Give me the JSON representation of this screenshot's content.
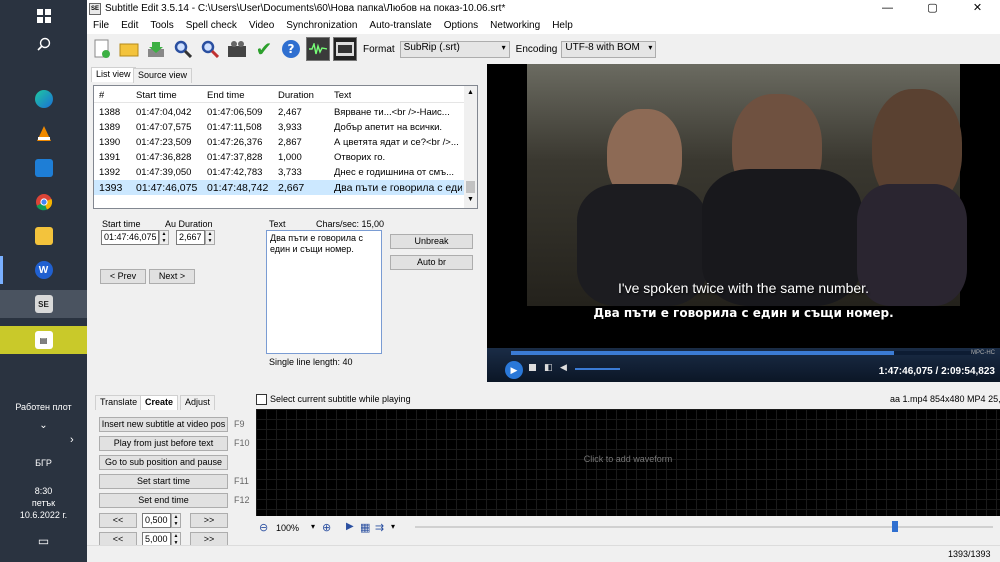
{
  "taskbar": {
    "desktop_label": "Работен плот",
    "chevron_down": "»",
    "language": "БГР",
    "time": "8:30",
    "weekday": "петък",
    "date": "10.6.2022 г."
  },
  "window": {
    "title": "Subtitle Edit 3.5.14 - C:\\Users\\User\\Documents\\60\\Нова папка\\Любов на показ-10.06.srt*"
  },
  "menu": [
    "File",
    "Edit",
    "Tools",
    "Spell check",
    "Video",
    "Synchronization",
    "Auto-translate",
    "Options",
    "Networking",
    "Help"
  ],
  "toolbar": {
    "format_label": "Format",
    "format_value": "SubRip (.srt)",
    "encoding_label": "Encoding",
    "encoding_value": "UTF-8 with BOM"
  },
  "tabs": {
    "list_view": "List view",
    "source_view": "Source view"
  },
  "list": {
    "columns": [
      "#",
      "Start time",
      "End time",
      "Duration",
      "Text"
    ],
    "rows": [
      {
        "num": "1388",
        "start": "01:47:04,042",
        "end": "01:47:06,509",
        "dur": "2,467",
        "text": "Вярване ти...<br />-Наис..."
      },
      {
        "num": "1389",
        "start": "01:47:07,575",
        "end": "01:47:11,508",
        "dur": "3,933",
        "text": "Добър апетит на всички."
      },
      {
        "num": "1390",
        "start": "01:47:23,509",
        "end": "01:47:26,376",
        "dur": "2,867",
        "text": "А цветята ядат и се?<br />..."
      },
      {
        "num": "1391",
        "start": "01:47:36,828",
        "end": "01:47:37,828",
        "dur": "1,000",
        "text": "Отворих го."
      },
      {
        "num": "1392",
        "start": "01:47:39,050",
        "end": "01:47:42,783",
        "dur": "3,733",
        "text": "Днес е годишнина от смъ..."
      },
      {
        "num": "1393",
        "start": "01:47:46,075",
        "end": "01:47:48,742",
        "dur": "2,667",
        "text": "Два пъти е говорила с еди"
      }
    ],
    "selected_index": 5
  },
  "edit": {
    "start_time_label": "Start time",
    "start_time_value": "01:47:46,075",
    "duration_label": "Au Duration",
    "duration_value": "2,667",
    "text_label": "Text",
    "chars_sec": "Chars/sec: 15,00",
    "text_line1": "Два пъти е говорила с",
    "text_line2": "един и същи номер.",
    "single_line_length": "Single line length: 40",
    "unbreak": "Unbreak",
    "auto_br": "Auto br",
    "prev": "< Prev",
    "next": "Next >"
  },
  "video": {
    "subtitle_en": "I've spoken twice with the same number.",
    "subtitle_bg": "Два пъти е говорила с един и същи номер.",
    "timecode": "1:47:46,075 / 2:09:54,823",
    "brand": "MPC-HC",
    "position_fraction": 0.83
  },
  "bottom_tabs": {
    "translate": "Translate",
    "create": "Create",
    "adjust": "Adjust"
  },
  "select_current_label": "Select current subtitle while playing",
  "media_info": "aa 1.mp4 854x480 MP4 25,0",
  "create_panel": {
    "insert_new": "Insert new subtitle at video pos",
    "insert_key": "F9",
    "play_before": "Play from just before text",
    "play_key": "F10",
    "goto_pause": "Go to sub position and pause",
    "set_start": "Set start time",
    "start_key": "F11",
    "set_end": "Set end time",
    "end_key": "F12",
    "back": "<<",
    "forward": ">>",
    "step1": "0,500",
    "step2": "5,000"
  },
  "waveform": {
    "placeholder": "Click to add waveform",
    "zoom": "100%",
    "slider_fraction": 0.83
  },
  "status": {
    "count": "1393/1393"
  },
  "colors": {
    "taskbar": "#2a3340",
    "selection": "#cce8ff",
    "video_progress": "#3b7bd4"
  }
}
